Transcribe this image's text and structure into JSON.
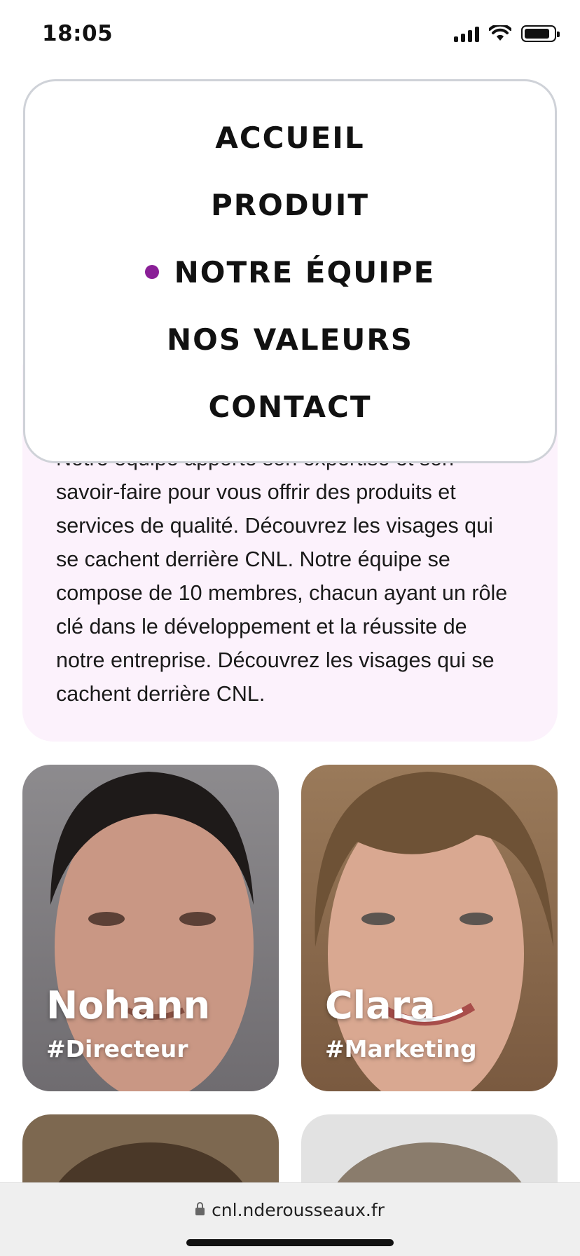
{
  "status_bar": {
    "time": "18:05"
  },
  "menu": {
    "items": [
      {
        "label": "ACCUEIL",
        "active": false
      },
      {
        "label": "PRODUIT",
        "active": false
      },
      {
        "label": "NOTRE ÉQUIPE",
        "active": true
      },
      {
        "label": "NOS VALEURS",
        "active": false
      },
      {
        "label": "CONTACT",
        "active": false
      }
    ],
    "active_dot_color": "#8a1f97"
  },
  "about": {
    "text": "Notre équipe apporte son expertise et son savoir-faire pour vous offrir des produits et services de qualité. Découvrez les visages qui se cachent derrière CNL. Notre équipe se compose de 10 membres, chacun ayant un rôle clé dans le développement et la réussite de notre entreprise. Découvrez les visages qui se cachent derrière CNL."
  },
  "team": [
    {
      "name": "Nohann",
      "role": "#Directeur"
    },
    {
      "name": "Clara",
      "role": "#Marketing"
    }
  ],
  "browser": {
    "url": "cnl.nderousseaux.fr"
  }
}
